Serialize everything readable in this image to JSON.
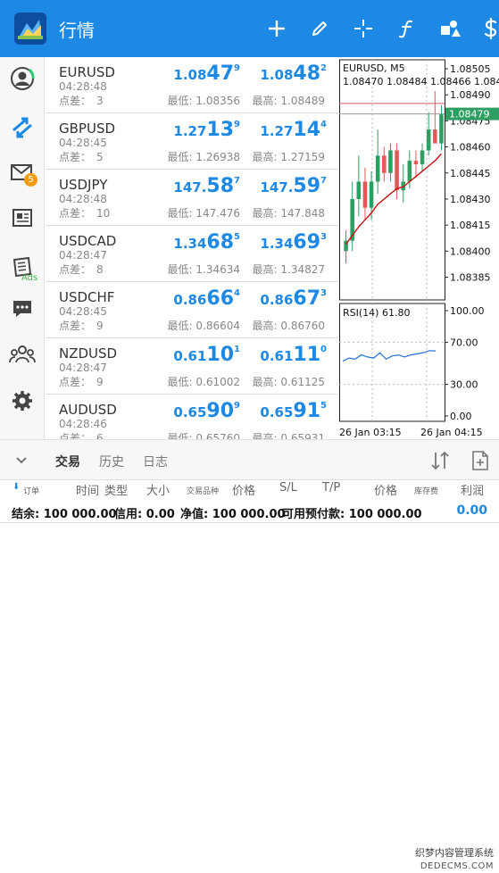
{
  "app": {
    "title": "行情",
    "toolbar_icons": [
      "plus-icon",
      "pencil-icon",
      "crosshair-icon",
      "function-icon",
      "objects-icon",
      "dollar-icon"
    ]
  },
  "sidebar": {
    "items": [
      "account-icon",
      "trade-arrows-icon",
      "mail-icon",
      "news-icon",
      "ads-icon",
      "chat-icon",
      "community-icon",
      "settings-icon"
    ],
    "mail_badge": "5",
    "ads_label": "Ads"
  },
  "quotes": [
    {
      "symbol": "EURUSD",
      "time": "04:28:48",
      "spread_label": "点差：",
      "spread": "3",
      "bid": {
        "p1": "1.08",
        "p2": "47",
        "p3": "9"
      },
      "ask": {
        "p1": "1.08",
        "p2": "48",
        "p3": "2"
      },
      "low": "最低: 1.08356",
      "high": "最高: 1.08489"
    },
    {
      "symbol": "GBPUSD",
      "time": "04:28:45",
      "spread_label": "点差：",
      "spread": "5",
      "bid": {
        "p1": "1.27",
        "p2": "13",
        "p3": "9"
      },
      "ask": {
        "p1": "1.27",
        "p2": "14",
        "p3": "4"
      },
      "low": "最低: 1.26938",
      "high": "最高: 1.27159"
    },
    {
      "symbol": "USDJPY",
      "time": "04:28:48",
      "spread_label": "点差：",
      "spread": "10",
      "bid": {
        "p1": "147.",
        "p2": "58",
        "p3": "7"
      },
      "ask": {
        "p1": "147.",
        "p2": "59",
        "p3": "7"
      },
      "low": "最低: 147.476",
      "high": "最高: 147.848"
    },
    {
      "symbol": "USDCAD",
      "time": "04:28:47",
      "spread_label": "点差：",
      "spread": "8",
      "bid": {
        "p1": "1.34",
        "p2": "68",
        "p3": "5"
      },
      "ask": {
        "p1": "1.34",
        "p2": "69",
        "p3": "3"
      },
      "low": "最低: 1.34634",
      "high": "最高: 1.34827"
    },
    {
      "symbol": "USDCHF",
      "time": "04:28:45",
      "spread_label": "点差：",
      "spread": "9",
      "bid": {
        "p1": "0.86",
        "p2": "66",
        "p3": "4"
      },
      "ask": {
        "p1": "0.86",
        "p2": "67",
        "p3": "3"
      },
      "low": "最低: 0.86604",
      "high": "最高: 0.86760"
    },
    {
      "symbol": "NZDUSD",
      "time": "04:28:47",
      "spread_label": "点差：",
      "spread": "9",
      "bid": {
        "p1": "0.61",
        "p2": "10",
        "p3": "1"
      },
      "ask": {
        "p1": "0.61",
        "p2": "11",
        "p3": "0"
      },
      "low": "最低: 0.61002",
      "high": "最高: 0.61125"
    },
    {
      "symbol": "AUDUSD",
      "time": "04:28:46",
      "spread_label": "点差：",
      "spread": "6",
      "bid": {
        "p1": "0.65",
        "p2": "90",
        "p3": "9"
      },
      "ask": {
        "p1": "0.65",
        "p2": "91",
        "p3": "5"
      },
      "low": "最低: 0.65760",
      "high": "最高: 0.65931"
    }
  ],
  "chart_data": [
    {
      "type": "candlestick",
      "title": "EURUSD, M5",
      "ohlc_text": "1.08470 1.08484 1.08466 1.084",
      "ylim": [
        1.08375,
        1.08505
      ],
      "y_ticks": [
        "1.08505",
        "1.08490",
        "1.08475",
        "1.08460",
        "1.08445",
        "1.08430",
        "1.08415",
        "1.08400",
        "1.08385"
      ],
      "current_price": "1.08479",
      "current_price_value": 1.08479,
      "high_line_value": 1.08485,
      "bull_color": "#2e9e63",
      "bear_color": "#e05a5a",
      "ma_color": "#cc1111",
      "candles": [
        {
          "o": 1.084,
          "h": 1.08412,
          "l": 1.08393,
          "c": 1.08406
        },
        {
          "o": 1.08406,
          "h": 1.0844,
          "l": 1.084,
          "c": 1.0843
        },
        {
          "o": 1.0843,
          "h": 1.08455,
          "l": 1.0842,
          "c": 1.0844
        },
        {
          "o": 1.0844,
          "h": 1.08448,
          "l": 1.08418,
          "c": 1.08425
        },
        {
          "o": 1.08425,
          "h": 1.08446,
          "l": 1.08418,
          "c": 1.0844
        },
        {
          "o": 1.0844,
          "h": 1.0847,
          "l": 1.08433,
          "c": 1.08455
        },
        {
          "o": 1.08455,
          "h": 1.0846,
          "l": 1.0844,
          "c": 1.08445
        },
        {
          "o": 1.08445,
          "h": 1.08462,
          "l": 1.0844,
          "c": 1.08458
        },
        {
          "o": 1.08458,
          "h": 1.08462,
          "l": 1.0843,
          "c": 1.08435
        },
        {
          "o": 1.08435,
          "h": 1.0845,
          "l": 1.08428,
          "c": 1.0844
        },
        {
          "o": 1.0844,
          "h": 1.08458,
          "l": 1.08436,
          "c": 1.08452
        },
        {
          "o": 1.08452,
          "h": 1.08458,
          "l": 1.08442,
          "c": 1.0845
        },
        {
          "o": 1.0845,
          "h": 1.08462,
          "l": 1.08446,
          "c": 1.08458
        },
        {
          "o": 1.08458,
          "h": 1.0848,
          "l": 1.08455,
          "c": 1.0847
        },
        {
          "o": 1.0847,
          "h": 1.08492,
          "l": 1.08465,
          "c": 1.08462
        },
        {
          "o": 1.08462,
          "h": 1.08484,
          "l": 1.08458,
          "c": 1.08479
        }
      ],
      "ma": [
        1.08404,
        1.08409,
        1.08414,
        1.08418,
        1.08422,
        1.08427,
        1.0843,
        1.08433,
        1.08436,
        1.08437,
        1.0844,
        1.08443,
        1.08446,
        1.08449,
        1.08452,
        1.08456
      ]
    },
    {
      "type": "line",
      "title": "RSI(14) 61.80",
      "ylim": [
        0,
        100
      ],
      "y_ticks": [
        "100.00",
        "70.00",
        "30.00",
        "0.00"
      ],
      "levels": [
        70,
        30
      ],
      "line_color": "#1e6fd9",
      "values": [
        52,
        55,
        54,
        58,
        56,
        55,
        60,
        54,
        57,
        58,
        56,
        58,
        59,
        60,
        62,
        61.8
      ],
      "x_labels": [
        "26 Jan 03:15",
        "26 Jan 04:15"
      ]
    }
  ],
  "bottom": {
    "tabs": [
      "交易",
      "历史",
      "日志"
    ],
    "active_tab": 0,
    "columns": [
      "订单",
      "时间",
      "类型",
      "大小",
      "交易品种",
      "价格",
      "S/L",
      "T/P",
      "价格",
      "库存费",
      "利润"
    ],
    "summary": {
      "balance": "结余: 100 000.00",
      "credit": "信用: 0.00",
      "equity": "净值: 100 000.00",
      "free_margin": "可用预付款: 100 000.00"
    },
    "profit_total": "0.00"
  },
  "watermark": {
    "line1": "织梦内容管理系统",
    "line2": "DEDECMS.COM"
  }
}
